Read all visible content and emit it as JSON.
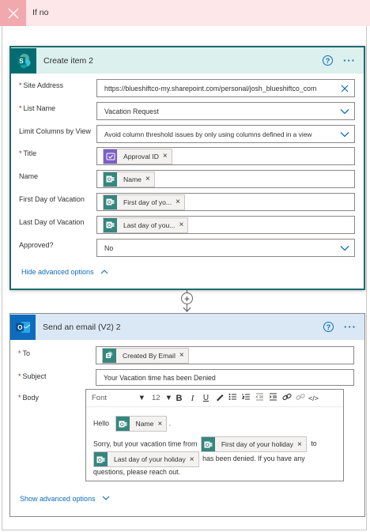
{
  "branch": {
    "title": "If no"
  },
  "create_item": {
    "title": "Create item 2",
    "fields": {
      "site_address": {
        "label": "Site Address",
        "value": "https://blueshiftco-my.sharepoint.com/personal/josh_blueshiftco_com"
      },
      "list_name": {
        "label": "List Name",
        "value": "Vacation Request"
      },
      "limit_columns": {
        "label": "Limit Columns by View",
        "value": "Avoid column threshold issues by only using columns defined in a view"
      },
      "title": {
        "label": "Title",
        "token": "Approval ID"
      },
      "name": {
        "label": "Name",
        "token": "Name"
      },
      "first_day": {
        "label": "First Day of Vacation",
        "token": "First day of yo..."
      },
      "last_day": {
        "label": "Last Day of Vacation",
        "token": "Last day of you..."
      },
      "approved": {
        "label": "Approved?",
        "value": "No"
      }
    },
    "advanced_link": "Hide advanced options"
  },
  "send_email": {
    "title": "Send an email (V2) 2",
    "fields": {
      "to": {
        "label": "To",
        "token": "Created By Email"
      },
      "subject": {
        "label": "Subject",
        "value": "Your Vacation time has been Denied"
      },
      "body": {
        "label": "Body"
      }
    },
    "toolbar": {
      "font": "Font",
      "size": "12"
    },
    "body": {
      "hello": "Hello",
      "name_token": "Name",
      "period": ".",
      "sorry": "Sorry, but your vacation time from",
      "first_token": "First day of your holiday",
      "to": "to",
      "last_token": "Last day of your holiday",
      "denied": "has been denied. If you have any",
      "questions": "questions, please reach out."
    },
    "advanced_link": "Show advanced options"
  },
  "colors": {
    "accent": "#0f6cbd",
    "sharepoint": "#036c70",
    "outlook": "#0f6cbd",
    "branch_no": "#fde7e9"
  }
}
